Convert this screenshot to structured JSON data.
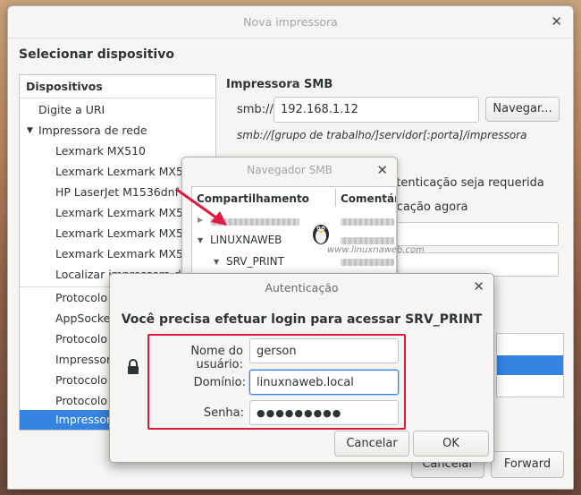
{
  "window": {
    "title": "Nova impressora",
    "heading": "Selecionar dispositivo"
  },
  "device_list": {
    "header": "Dispositivos",
    "items": [
      "Digite a URI",
      "Impressora de rede",
      "Lexmark MX510",
      "Lexmark Lexmark MX511d",
      "HP LaserJet M1536dnf M",
      "Lexmark Lexmark MX511d",
      "Lexmark Lexmark MX511d",
      "Lexmark Lexmark MX511d",
      "Localizar impressora de r",
      "Protocolo d",
      "AppSocket/",
      "Protocolo d",
      "Impressora",
      "Protocolo d",
      "Protocolo d",
      "Impressora"
    ]
  },
  "smb": {
    "heading": "Impressora SMB",
    "uri_label": "smb://",
    "uri_value": "192.168.1.12",
    "browse_button": "Navegar...",
    "hint": "smb://[grupo de trabalho/]servidor[:porta]/impressora",
    "auth_option_required": "utenticação seja requerida",
    "auth_option_now": "ticação agora"
  },
  "smb_browser": {
    "title": "Navegador SMB",
    "col_share": "Compartilhamento",
    "col_comment": "Comentár",
    "node_linuxnaweb": "LINUXNAWEB",
    "node_srv_print": "SRV_PRINT"
  },
  "watermark": "www.linuxnaweb.com",
  "auth": {
    "title": "Autenticação",
    "prompt": "Você precisa efetuar login para acessar SRV_PRINT",
    "username_label": "Nome do usuário:",
    "username_value": "gerson",
    "domain_label": "Domínio:",
    "domain_value": "linuxnaweb.local",
    "password_label": "Senha:",
    "password_value": "●●●●●●●●●",
    "cancel": "Cancelar",
    "ok": "OK"
  },
  "footer": {
    "cancel": "Cancelar",
    "forward": "Forward"
  },
  "colors": {
    "selection": "#3584e4",
    "highlight_box": "#e0193f",
    "arrow": "#e0193f"
  }
}
